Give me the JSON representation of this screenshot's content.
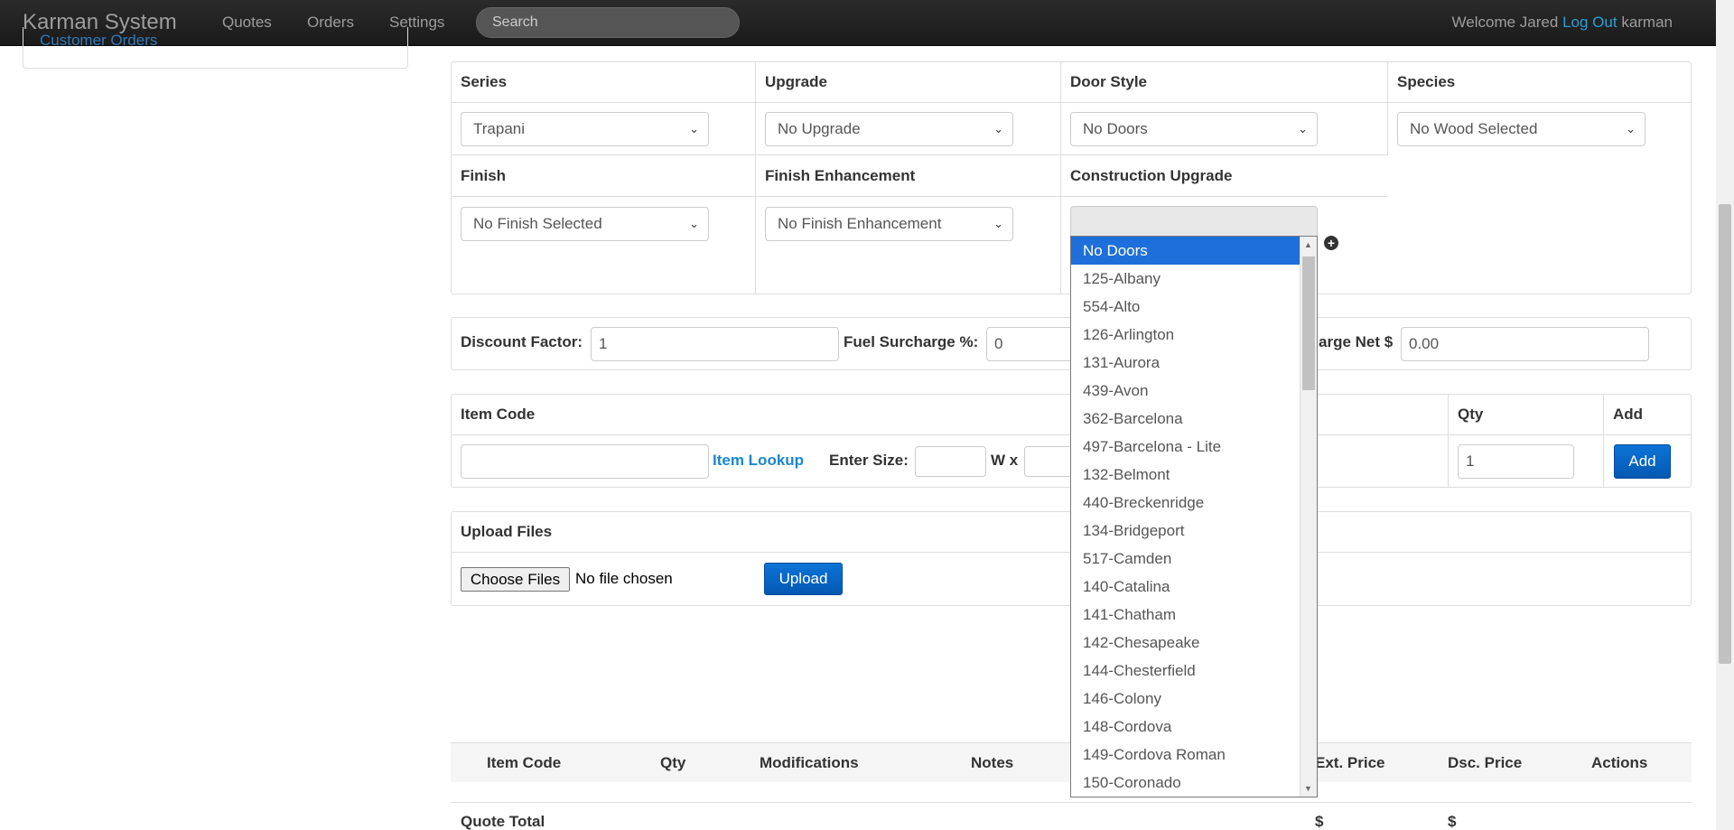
{
  "navbar": {
    "brand": "Karman System",
    "links": [
      "Quotes",
      "Orders",
      "Settings"
    ],
    "search_placeholder": "Search",
    "welcome": "Welcome Jared",
    "logout": "Log Out",
    "username": "karman"
  },
  "sidebar": {
    "link": "Customer Orders"
  },
  "options": {
    "series_label": "Series",
    "series_value": "Trapani",
    "upgrade_label": "Upgrade",
    "upgrade_value": "No Upgrade",
    "door_style_label": "Door Style",
    "door_style_value": "No Doors",
    "species_label": "Species",
    "species_value": "No Wood Selected",
    "finish_label": "Finish",
    "finish_value": "No Finish Selected",
    "finish_enh_label": "Finish Enhancement",
    "finish_enh_value": "No Finish Enhancement",
    "construction_label": "Construction Upgrade",
    "construction_value": ""
  },
  "discount": {
    "discount_label": "Discount Factor:",
    "discount_value": "1",
    "fuel_label": "Fuel Surcharge %:",
    "fuel_value": "0",
    "charge_net_label": "arge Net $",
    "charge_net_value": "0.00"
  },
  "item": {
    "item_code_label": "Item Code",
    "item_lookup": "Item Lookup",
    "enter_size": "Enter Size:",
    "w_x": "W x",
    "qty_label": "Qty",
    "qty_value": "1",
    "add_label": "Add",
    "add_button": "Add"
  },
  "upload": {
    "title": "Upload Files",
    "choose": "Choose Files",
    "no_file": "No file chosen",
    "upload_button": "Upload"
  },
  "table": {
    "headers": [
      "Item Code",
      "Qty",
      "Modifications",
      "Notes",
      "Ext. Price",
      "Dsc. Price",
      "Actions"
    ],
    "total_label": "Quote Total",
    "ext_total": "$",
    "dsc_total": "$"
  },
  "dropdown": {
    "items": [
      "No Doors",
      "125-Albany",
      "554-Alto",
      "126-Arlington",
      "131-Aurora",
      "439-Avon",
      "362-Barcelona",
      "497-Barcelona - Lite",
      "132-Belmont",
      "440-Breckenridge",
      "134-Bridgeport",
      "517-Camden",
      "140-Catalina",
      "141-Chatham",
      "142-Chesapeake",
      "144-Chesterfield",
      "146-Colony",
      "148-Cordova",
      "149-Cordova Roman",
      "150-Coronado"
    ],
    "selected": "No Doors"
  }
}
